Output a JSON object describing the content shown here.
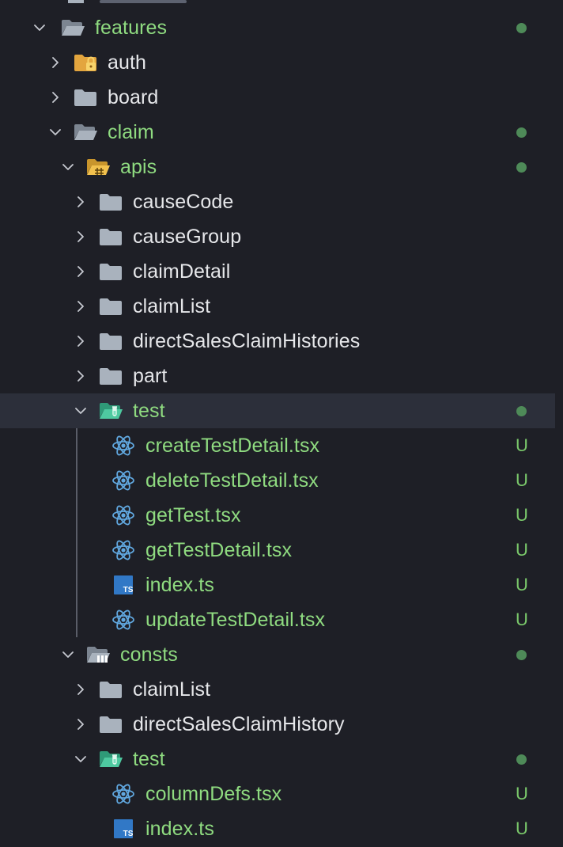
{
  "explorer": {
    "rows": [
      {
        "label": "features",
        "kind": "folder-open",
        "expanded": true,
        "depth": 0,
        "color": "changed",
        "dot": true,
        "badge": ""
      },
      {
        "label": "auth",
        "kind": "folder-lock",
        "expanded": false,
        "depth": 1,
        "color": "plain",
        "dot": false,
        "badge": ""
      },
      {
        "label": "board",
        "kind": "folder",
        "expanded": false,
        "depth": 1,
        "color": "plain",
        "dot": false,
        "badge": ""
      },
      {
        "label": "claim",
        "kind": "folder-open",
        "expanded": true,
        "depth": 1,
        "color": "changed",
        "dot": true,
        "badge": ""
      },
      {
        "label": "apis",
        "kind": "folder-api",
        "expanded": true,
        "depth": 2,
        "color": "changed",
        "dot": true,
        "badge": ""
      },
      {
        "label": "causeCode",
        "kind": "folder",
        "expanded": false,
        "depth": 3,
        "color": "plain",
        "dot": false,
        "badge": ""
      },
      {
        "label": "causeGroup",
        "kind": "folder",
        "expanded": false,
        "depth": 3,
        "color": "plain",
        "dot": false,
        "badge": ""
      },
      {
        "label": "claimDetail",
        "kind": "folder",
        "expanded": false,
        "depth": 3,
        "color": "plain",
        "dot": false,
        "badge": ""
      },
      {
        "label": "claimList",
        "kind": "folder",
        "expanded": false,
        "depth": 3,
        "color": "plain",
        "dot": false,
        "badge": ""
      },
      {
        "label": "directSalesClaimHistories",
        "kind": "folder",
        "expanded": false,
        "depth": 3,
        "color": "plain",
        "dot": false,
        "badge": ""
      },
      {
        "label": "part",
        "kind": "folder",
        "expanded": false,
        "depth": 3,
        "color": "plain",
        "dot": false,
        "badge": ""
      },
      {
        "label": "test",
        "kind": "folder-test",
        "expanded": true,
        "depth": 3,
        "color": "changed",
        "dot": true,
        "badge": "",
        "selected": true
      },
      {
        "label": "createTestDetail.tsx",
        "kind": "react",
        "depth": 4,
        "color": "changed",
        "dot": false,
        "badge": "U"
      },
      {
        "label": "deleteTestDetail.tsx",
        "kind": "react",
        "depth": 4,
        "color": "changed",
        "dot": false,
        "badge": "U"
      },
      {
        "label": "getTest.tsx",
        "kind": "react",
        "depth": 4,
        "color": "changed",
        "dot": false,
        "badge": "U"
      },
      {
        "label": "getTestDetail.tsx",
        "kind": "react",
        "depth": 4,
        "color": "changed",
        "dot": false,
        "badge": "U"
      },
      {
        "label": "index.ts",
        "kind": "typescript",
        "depth": 4,
        "color": "changed",
        "dot": false,
        "badge": "U"
      },
      {
        "label": "updateTestDetail.tsx",
        "kind": "react",
        "depth": 4,
        "color": "changed",
        "dot": false,
        "badge": "U"
      },
      {
        "label": "consts",
        "kind": "folder-consts",
        "expanded": true,
        "depth": 2,
        "color": "changed",
        "dot": true,
        "badge": ""
      },
      {
        "label": "claimList",
        "kind": "folder",
        "expanded": false,
        "depth": 3,
        "color": "plain",
        "dot": false,
        "badge": ""
      },
      {
        "label": "directSalesClaimHistory",
        "kind": "folder",
        "expanded": false,
        "depth": 3,
        "color": "plain",
        "dot": false,
        "badge": ""
      },
      {
        "label": "test",
        "kind": "folder-test",
        "expanded": true,
        "depth": 3,
        "color": "changed",
        "dot": true,
        "badge": ""
      },
      {
        "label": "columnDefs.tsx",
        "kind": "react",
        "depth": 4,
        "color": "changed",
        "dot": false,
        "badge": "U"
      },
      {
        "label": "index.ts",
        "kind": "typescript",
        "depth": 4,
        "color": "changed",
        "dot": false,
        "badge": "U"
      }
    ]
  },
  "colors": {
    "background": "#1e1f26",
    "selected_row": "#2c2f3a",
    "plain_text": "#e6e7ea",
    "changed_text": "#8fdb80",
    "untracked_badge": "#7bc96b",
    "modified_dot": "#4e8a58",
    "folder_gray": "#a9b2bd",
    "folder_test": "#4ec9a0",
    "folder_api": "#f2c14e",
    "react_blue": "#61a8e0",
    "ts_blue": "#3178c6"
  }
}
